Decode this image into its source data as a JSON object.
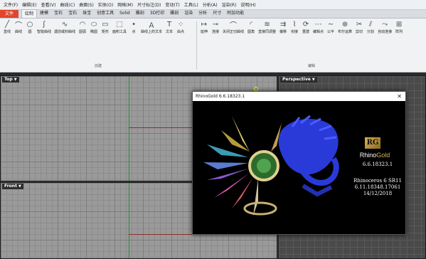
{
  "menu": [
    "文件(F)",
    "编辑(E)",
    "查看(V)",
    "曲线(C)",
    "曲面(S)",
    "实体(O)",
    "网格(M)",
    "尺寸标注(D)",
    "变动(T)",
    "工具(L)",
    "分析(A)",
    "渲染(R)",
    "说明(H)"
  ],
  "tabs": {
    "file": "文件",
    "items": [
      "绘制",
      "建模",
      "宝石",
      "宝石",
      "珠宝",
      "创意工具",
      "Solid",
      "雕刻",
      "3D打印",
      "雕刻",
      "渲染",
      "分析",
      "尺寸",
      "附加功能"
    ],
    "active_index": 0
  },
  "ribbon": {
    "draw_group": {
      "name": "创建",
      "items": [
        "直线",
        "曲线",
        "圆",
        "智能曲线",
        "遇前或封曲线",
        "圆弧",
        "椭圆",
        "矩形",
        "面积工具",
        "点",
        "曲线上的文本",
        "文本",
        "由点"
      ]
    },
    "edit_group": {
      "name": "编辑",
      "items": [
        "延伸",
        "连接",
        "关闭正切曲线",
        "圆角",
        "直接同调整",
        "偏移",
        "衔接",
        "重建",
        "编辑点",
        "公平",
        "布尔运算",
        "剪切",
        "分割",
        "自动连接",
        "阵列"
      ]
    }
  },
  "viewports": {
    "top": "Top",
    "front": "Front",
    "perspective": "Perspective"
  },
  "splash": {
    "title": "RhinoGold 6.6.18323.1",
    "close_glyph": "✕",
    "logo_mark": "RG",
    "logo_rhino": "Rhino",
    "logo_gold": "Gold",
    "version": "6.6.18323.1",
    "rhino_version": "Rhinoceros 6 SR11",
    "rhino_build": "6.11.18348.17061",
    "date": "14/12/2018"
  },
  "colors": {
    "file_tab": "#e2452b",
    "ribbon_bg": "#f1f2f4",
    "viewport_grid": "#9a9a9a",
    "gold": "#d8b458"
  }
}
